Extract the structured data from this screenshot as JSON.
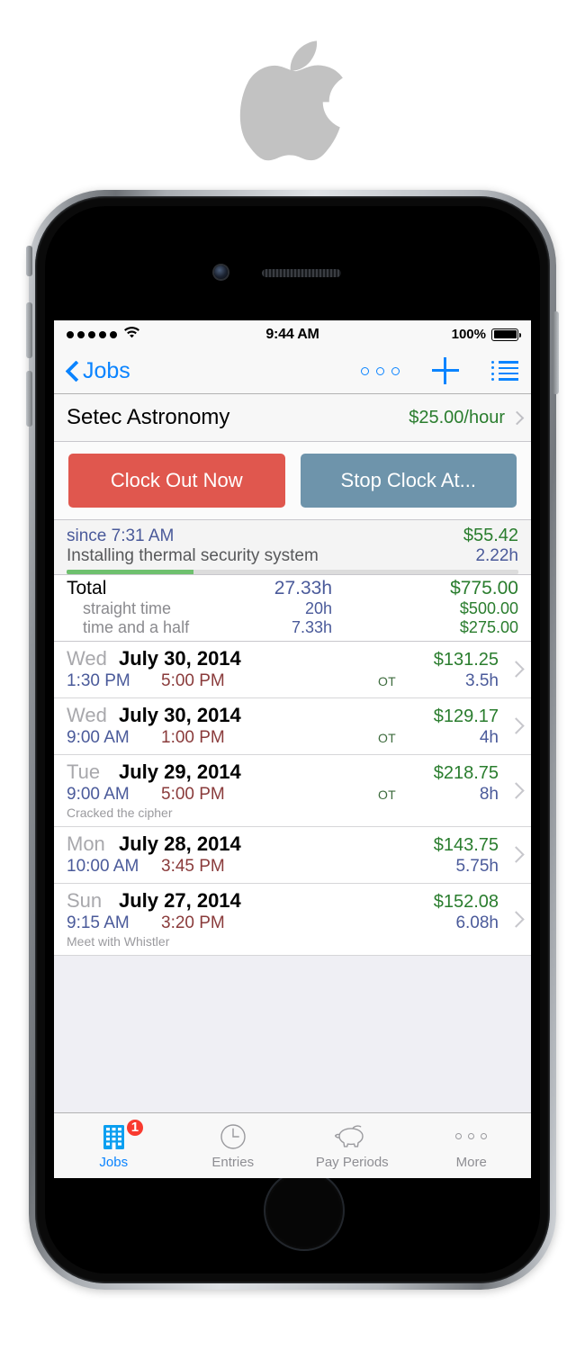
{
  "brand": {
    "logo": "apple-logo"
  },
  "status_bar": {
    "signal_dots": 5,
    "wifi": "wifi-icon",
    "time": "9:44 AM",
    "battery_percent": "100%"
  },
  "nav_bar": {
    "back_label": "Jobs",
    "actions": [
      {
        "name": "more-dots-icon",
        "glyph": "○ ○ ○"
      },
      {
        "name": "add-icon",
        "glyph": "+"
      },
      {
        "name": "list-icon",
        "glyph": "≔"
      }
    ]
  },
  "job": {
    "name": "Setec Astronomy",
    "rate": "$25.00/hour"
  },
  "actions": {
    "clock_out_label": "Clock Out Now",
    "clock_out_color": "#e0574e",
    "stop_clock_label": "Stop Clock At...",
    "stop_clock_color": "#6e94ab"
  },
  "current": {
    "since": "since 7:31 AM",
    "amount": "$55.42",
    "note": "Installing thermal security system",
    "hours": "2.22h",
    "progress_percent": 28,
    "progress_color": "#6ec06e"
  },
  "totals": {
    "rows": [
      {
        "label": "Total",
        "hours": "27.33h",
        "amount": "$775.00"
      },
      {
        "label": "straight time",
        "hours": "20h",
        "amount": "$500.00"
      },
      {
        "label": "time and a half",
        "hours": "7.33h",
        "amount": "$275.00"
      }
    ]
  },
  "entries": [
    {
      "dow": "Wed",
      "date": "July 30, 2014",
      "amount": "$131.25",
      "clock_in": "1:30 PM",
      "clock_out": "5:00 PM",
      "ot": "OT",
      "hours": "3.5h",
      "note": ""
    },
    {
      "dow": "Wed",
      "date": "July 30, 2014",
      "amount": "$129.17",
      "clock_in": "9:00 AM",
      "clock_out": "1:00 PM",
      "ot": "OT",
      "hours": "4h",
      "note": ""
    },
    {
      "dow": "Tue",
      "date": "July 29, 2014",
      "amount": "$218.75",
      "clock_in": "9:00 AM",
      "clock_out": "5:00 PM",
      "ot": "OT",
      "hours": "8h",
      "note": "Cracked the cipher"
    },
    {
      "dow": "Mon",
      "date": "July 28, 2014",
      "amount": "$143.75",
      "clock_in": "10:00 AM",
      "clock_out": "3:45 PM",
      "ot": "",
      "hours": "5.75h",
      "note": ""
    },
    {
      "dow": "Sun",
      "date": "July 27, 2014",
      "amount": "$152.08",
      "clock_in": "9:15 AM",
      "clock_out": "3:20 PM",
      "ot": "",
      "hours": "6.08h",
      "note": "Meet with Whistler"
    }
  ],
  "tab_bar": {
    "active": "Jobs",
    "tabs": [
      {
        "label": "Jobs",
        "icon": "building-icon",
        "badge": "1"
      },
      {
        "label": "Entries",
        "icon": "clock-icon",
        "badge": ""
      },
      {
        "label": "Pay Periods",
        "icon": "piggy-bank-icon",
        "badge": ""
      },
      {
        "label": "More",
        "icon": "more-dots-icon",
        "badge": ""
      }
    ]
  },
  "colors": {
    "accent_blue": "#0b84ff",
    "money_green": "#2a7d2e",
    "time_blue": "#4a5a9a",
    "clock_out_red": "#8a3b3b",
    "badge_red": "#f93a2f"
  }
}
